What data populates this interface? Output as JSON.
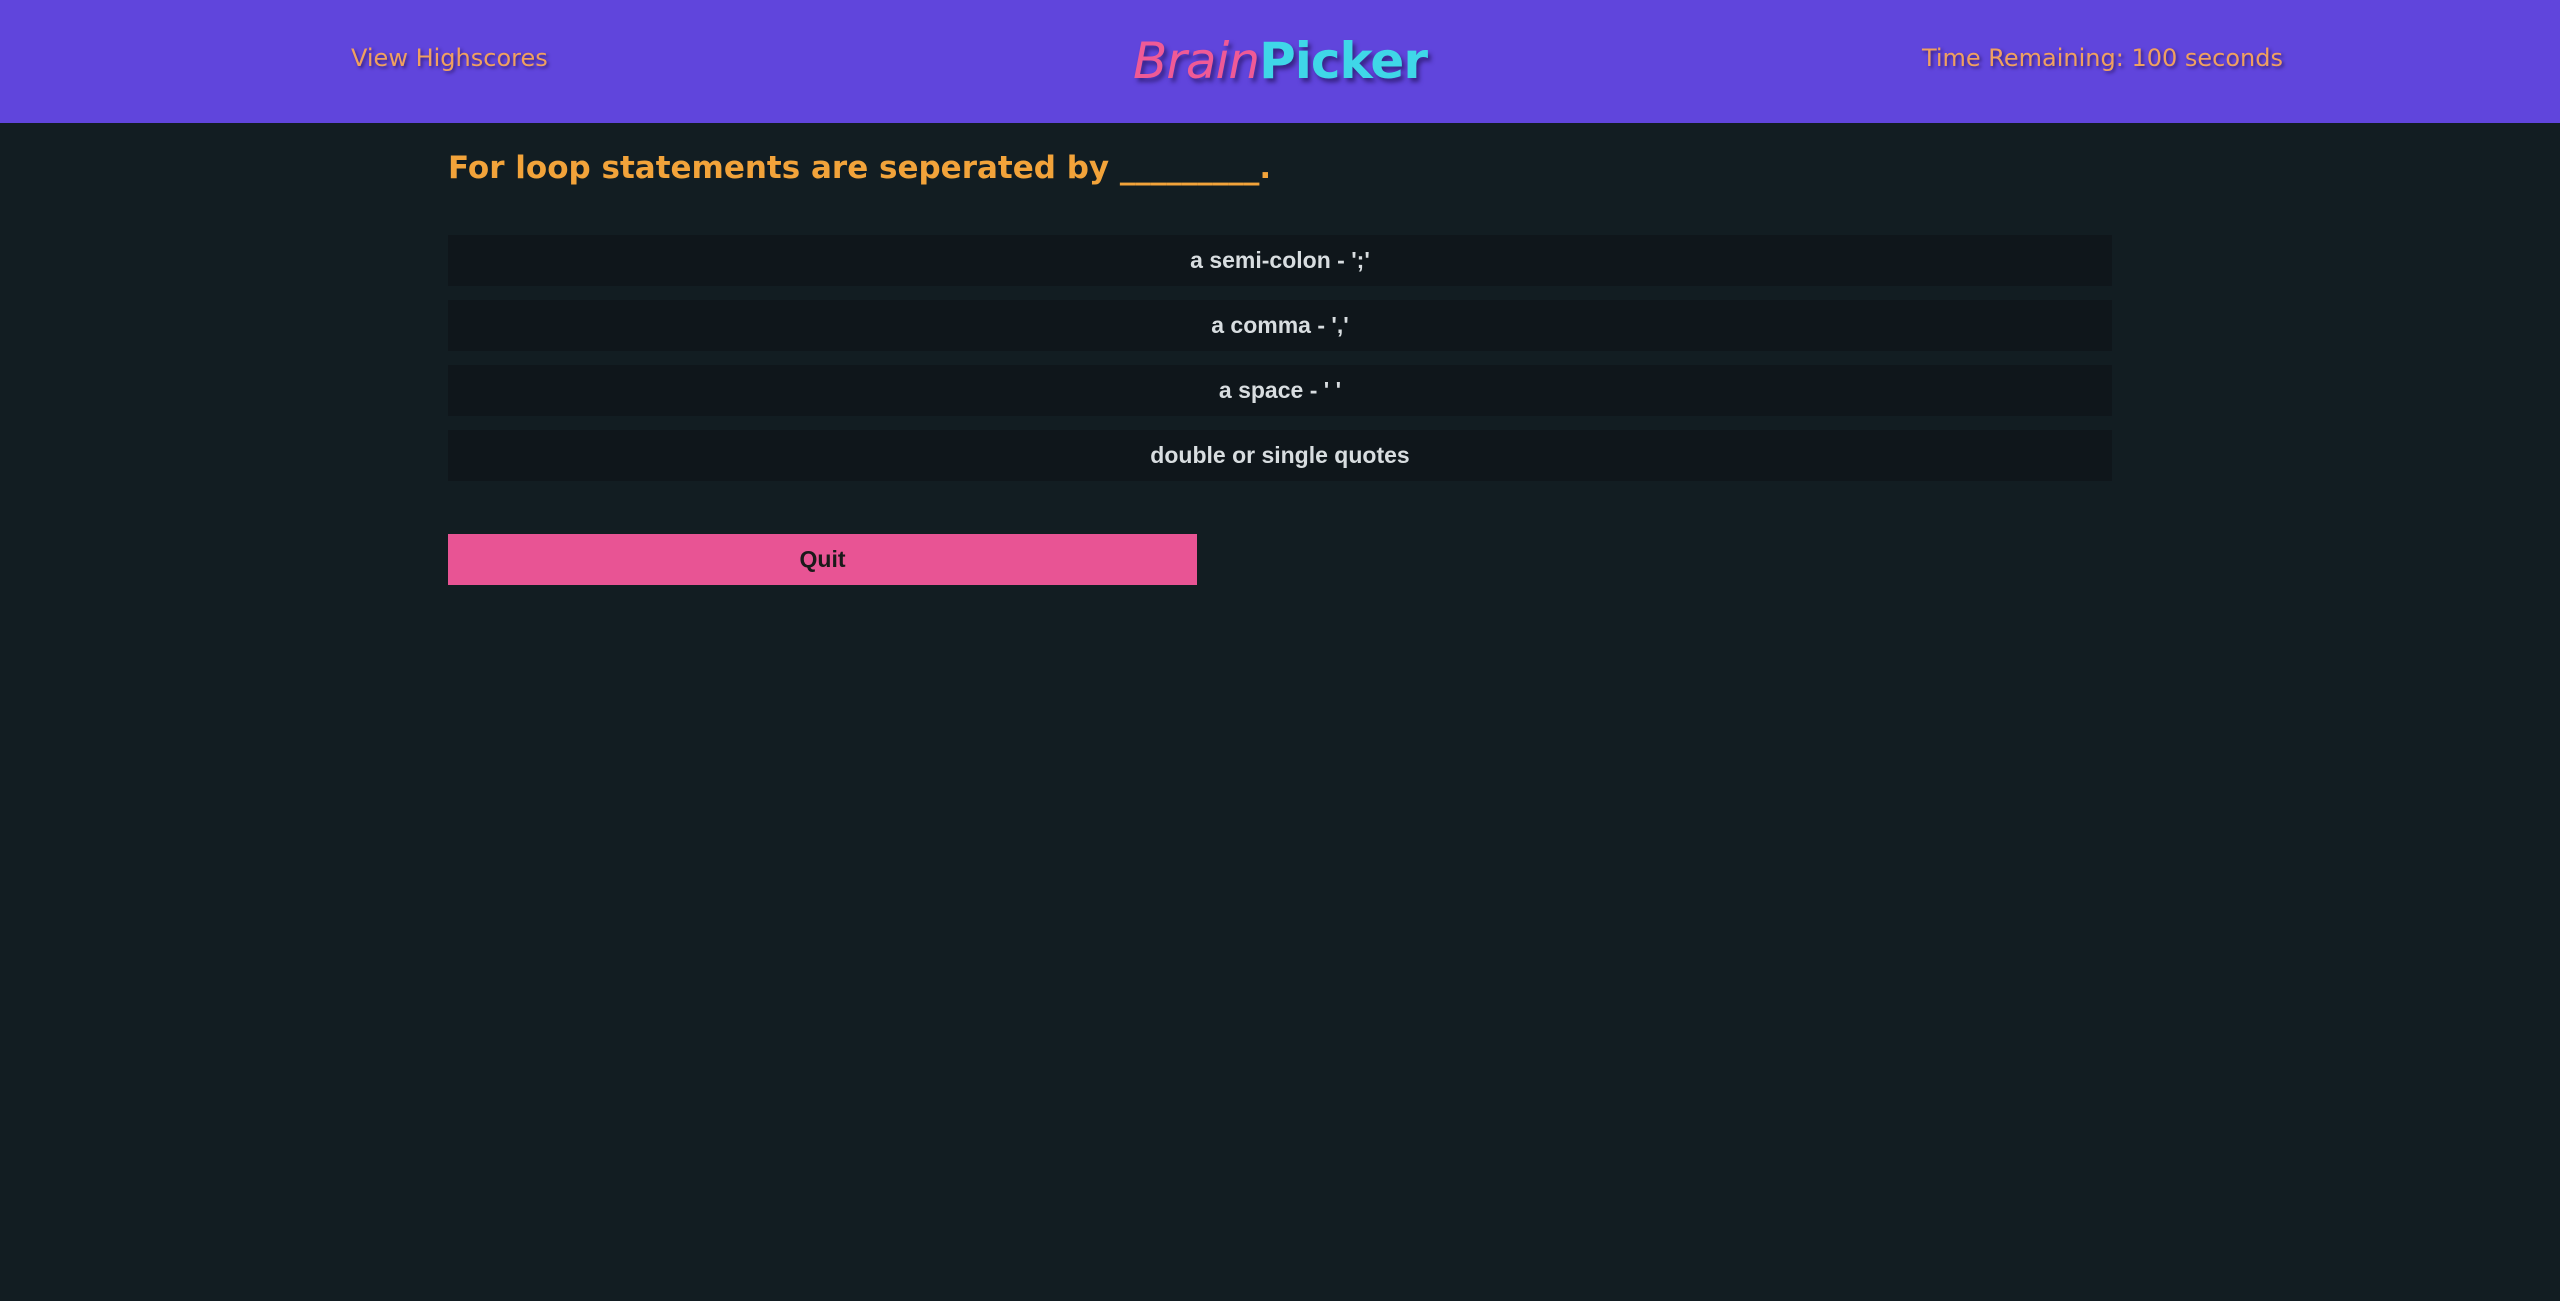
{
  "header": {
    "highscores_link": "View Highscores",
    "logo_part_1": "Brain",
    "logo_part_2": "Picker",
    "timer_text": "Time Remaining: 100 seconds"
  },
  "quiz": {
    "question": "For loop statements are seperated by _________.",
    "answers": [
      "a semi-colon - ';'",
      "a comma - ','",
      "a space - ' '",
      "double or single quotes"
    ],
    "quit_label": "Quit"
  },
  "colors": {
    "navbar": "#6045dc",
    "background": "#121d22",
    "accent_orange": "#f2a33a",
    "logo_pink": "#ef5a96",
    "logo_cyan": "#3fd7e8",
    "quit_button": "#e85494"
  }
}
